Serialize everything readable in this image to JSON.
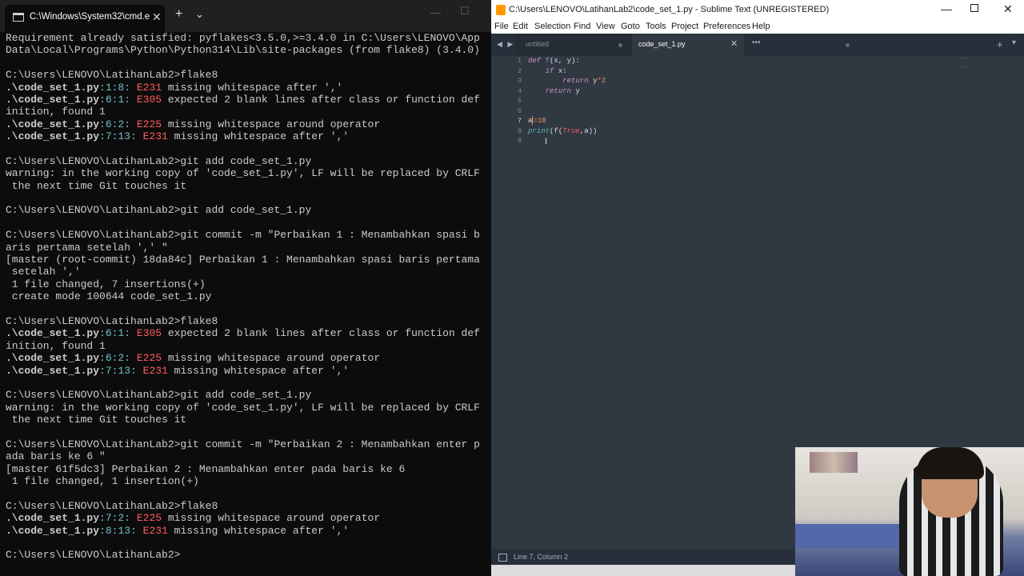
{
  "cmd": {
    "tab_title": "C:\\Windows\\System32\\cmd.e",
    "close_glyph": "✕",
    "newtab_glyph": "+",
    "dropdown_glyph": "⌄",
    "minimize_glyph": "—",
    "maximize_glyph": "☐",
    "lines": [
      "Requirement already satisfied: pyflakes<3.5.0,>=3.4.0 in C:\\Users\\LENOVO\\App",
      "Data\\Local\\Programs\\Python\\Python314\\Lib\\site-packages (from flake8) (3.4.0)",
      "",
      "C:\\Users\\LENOVO\\LatihanLab2>flake8",
      ".\\code_set_1.py:1:8: E231 missing whitespace after ','",
      ".\\code_set_1.py:6:1: E305 expected 2 blank lines after class or function def",
      "inition, found 1",
      ".\\code_set_1.py:6:2: E225 missing whitespace around operator",
      ".\\code_set_1.py:7:13: E231 missing whitespace after ','",
      "",
      "C:\\Users\\LENOVO\\LatihanLab2>git add code_set_1.py",
      "warning: in the working copy of 'code_set_1.py', LF will be replaced by CRLF",
      " the next time Git touches it",
      "",
      "C:\\Users\\LENOVO\\LatihanLab2>git add code_set_1.py",
      "",
      "C:\\Users\\LENOVO\\LatihanLab2>git commit -m \"Perbaikan 1 : Menambahkan spasi b",
      "aris pertama setelah ',' \"",
      "[master (root-commit) 18da84c] Perbaikan 1 : Menambahkan spasi baris pertama",
      " setelah ','",
      " 1 file changed, 7 insertions(+)",
      " create mode 100644 code_set_1.py",
      "",
      "C:\\Users\\LENOVO\\LatihanLab2>flake8",
      ".\\code_set_1.py:6:1: E305 expected 2 blank lines after class or function def",
      "inition, found 1",
      ".\\code_set_1.py:6:2: E225 missing whitespace around operator",
      ".\\code_set_1.py:7:13: E231 missing whitespace after ','",
      "",
      "C:\\Users\\LENOVO\\LatihanLab2>git add code_set_1.py",
      "warning: in the working copy of 'code_set_1.py', LF will be replaced by CRLF",
      " the next time Git touches it",
      "",
      "C:\\Users\\LENOVO\\LatihanLab2>git commit -m \"Perbaikan 2 : Menambahkan enter p",
      "ada baris ke 6 \"",
      "[master 61f5dc3] Perbaikan 2 : Menambahkan enter pada baris ke 6",
      " 1 file changed, 1 insertion(+)",
      "",
      "C:\\Users\\LENOVO\\LatihanLab2>flake8",
      ".\\code_set_1.py:7:2: E225 missing whitespace around operator",
      ".\\code_set_1.py:8:13: E231 missing whitespace after ','",
      "",
      "C:\\Users\\LENOVO\\LatihanLab2>"
    ]
  },
  "sublime": {
    "title": "C:\\Users\\LENOVO\\LatihanLab2\\code_set_1.py - Sublime Text (UNREGISTERED)",
    "min_glyph": "—",
    "close_glyph": "✕",
    "menu": [
      "File",
      "Edit",
      "Selection",
      "Find",
      "View",
      "Goto",
      "Tools",
      "Project",
      "Preferences",
      "Help"
    ],
    "tab_nav": "◀ ▶",
    "tabs": [
      {
        "label": "untitled"
      },
      {
        "label": "code_set_1.py",
        "close": "✕"
      }
    ],
    "more_glyph": "•••",
    "add_glyph": "+",
    "list_glyph": "▾",
    "line_numbers": [
      "1",
      "2",
      "3",
      "4",
      "5",
      "6",
      "7",
      "8",
      "9"
    ],
    "active_line": 7,
    "code": {
      "l1_kw": "def",
      "l1_fn": "f",
      "l1_rest": "(x, y):",
      "l2_kw": "if",
      "l2_rest": " x:",
      "l3_kw": "return",
      "l3_var": " y",
      "l3_op": "*",
      "l3_num": "2",
      "l4_kw": "return",
      "l4_rest": " y",
      "l7_var": "a",
      "l7_op": "=",
      "l7_num": "10",
      "l8_bi": "print",
      "l8_p1": "(f(",
      "l8_const": "True",
      "l8_p2": ",a))"
    },
    "status": "Line 7, Column 2"
  }
}
